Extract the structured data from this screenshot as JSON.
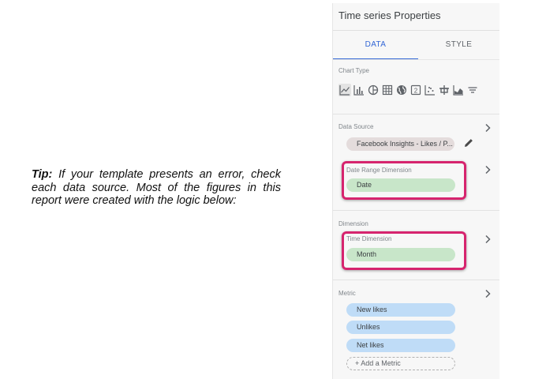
{
  "tip": {
    "lead": "Tip:",
    "body": " If your template presents an error, check each data source. Most of the figures in this report were created with the logic below:"
  },
  "panel": {
    "title": "Time series Properties",
    "tabs": [
      {
        "label": "DATA",
        "active": true
      },
      {
        "label": "STYLE",
        "active": false
      }
    ],
    "chart_type_label": "Chart Type",
    "chart_types": [
      "time-series-icon",
      "bar-chart-icon",
      "pie-chart-icon",
      "table-icon",
      "geo-map-icon",
      "scorecard-icon",
      "scatter-chart-icon",
      "pivot-table-icon",
      "area-chart-icon",
      "bullet-chart-icon"
    ],
    "data_source": {
      "label": "Data Source",
      "value": "Facebook Insights - Likes / P..."
    },
    "date_range": {
      "label": "Date Range Dimension",
      "value": "Date"
    },
    "dimension": {
      "label": "Dimension",
      "sub_label": "Time Dimension",
      "value": "Month"
    },
    "metric": {
      "label": "Metric",
      "items": [
        "New likes",
        "Unlikes",
        "Net likes"
      ],
      "add_label": "+ Add a Metric"
    },
    "colors": {
      "accent": "#3367d6",
      "highlight": "#d6246e",
      "dimension_pill": "#c8e6c9",
      "metric_pill": "#bfdcf7"
    }
  }
}
